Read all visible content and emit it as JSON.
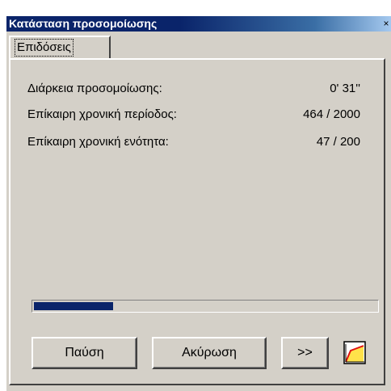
{
  "window": {
    "title": "Κατάσταση προσομοίωσης",
    "close_glyph": "×"
  },
  "tabs": [
    {
      "label": "Επιδόσεις",
      "selected": true
    }
  ],
  "stats": {
    "duration_label": "Διάρκεια προσομοίωσης:",
    "duration_value": "0' 31''",
    "period_label": "Επίκαιρη χρονική περίοδος:",
    "period_value": "464 / 2000",
    "unit_label": "Επίκαιρη χρονική ενότητα:",
    "unit_value": "47 / 200"
  },
  "progress": {
    "fraction": 0.232
  },
  "buttons": {
    "pause_label": "Παύση",
    "cancel_label": "Ακύρωση",
    "more_label": ">>",
    "chart_icon": "line-chart-icon"
  },
  "colors": {
    "title_bar": "#0a246a",
    "progress_fill": "#0a246a",
    "chart_line": "#e01010",
    "chart_fill": "#ffe24a"
  }
}
